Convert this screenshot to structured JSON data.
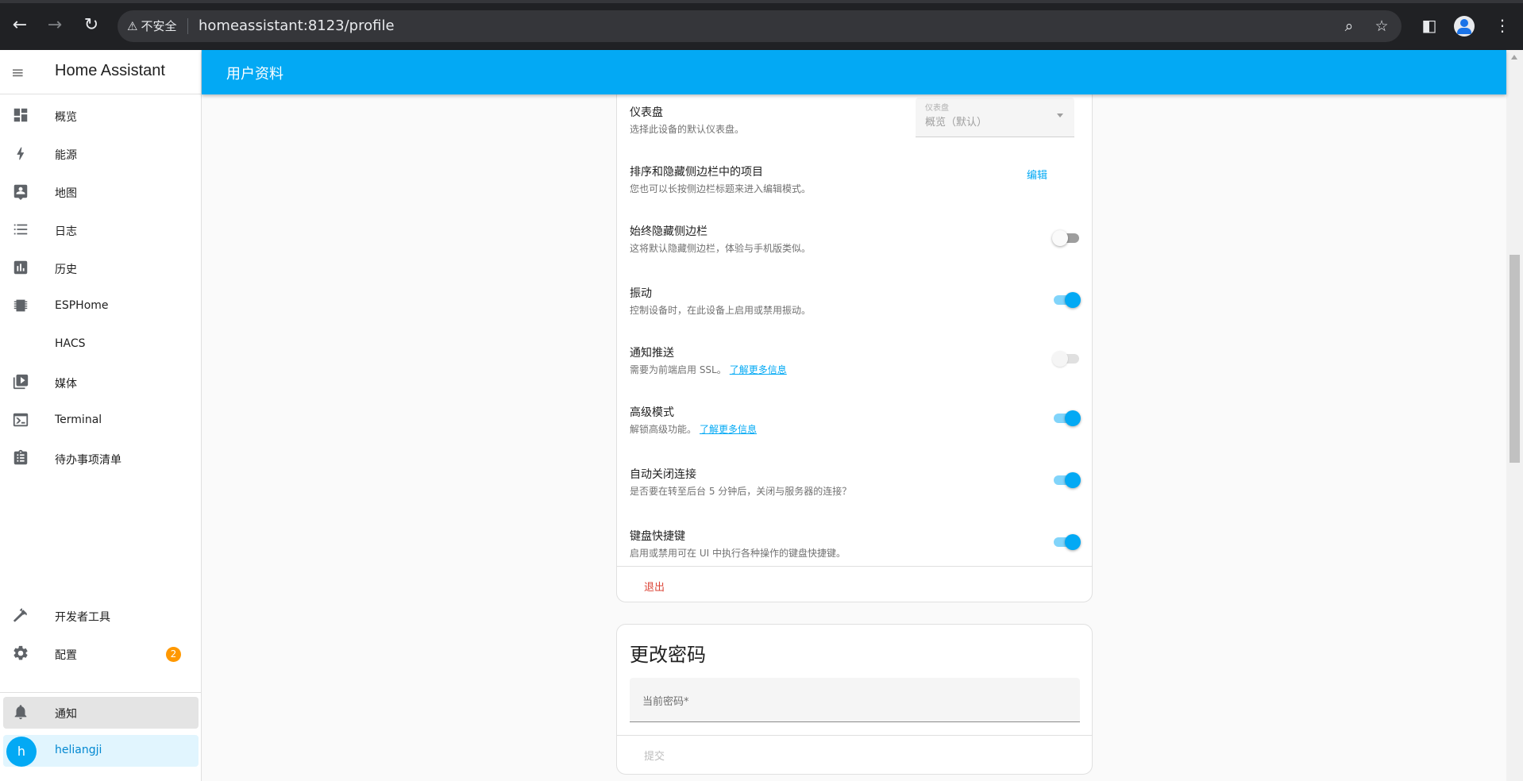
{
  "browser": {
    "security_label": "不安全",
    "url": "homeassistant:8123/profile"
  },
  "sidebar": {
    "title": "Home Assistant",
    "items": [
      {
        "label": "概览",
        "icon": "dashboard-icon"
      },
      {
        "label": "能源",
        "icon": "lightning-icon"
      },
      {
        "label": "地图",
        "icon": "map-account-icon"
      },
      {
        "label": "日志",
        "icon": "list-icon"
      },
      {
        "label": "历史",
        "icon": "chart-icon"
      },
      {
        "label": "ESPHome",
        "icon": "chip-icon"
      },
      {
        "label": "HACS",
        "icon": ""
      },
      {
        "label": "媒体",
        "icon": "media-play-icon"
      },
      {
        "label": "Terminal",
        "icon": "console-icon"
      },
      {
        "label": "待办事项清单",
        "icon": "clipboard-list-icon"
      }
    ],
    "developer_tools": "开发者工具",
    "settings": "配置",
    "settings_badge": "2",
    "notifications": "通知",
    "user_initial": "h",
    "user_name": "heliangji"
  },
  "header": {
    "title": "用户资料"
  },
  "settings": {
    "dashboard": {
      "title": "仪表盘",
      "desc": "选择此设备的默认仪表盘。",
      "select_label": "仪表盘",
      "select_value": "概览（默认）"
    },
    "sidebar_order": {
      "title": "排序和隐藏侧边栏中的项目",
      "desc": "您也可以长按侧边栏标题来进入编辑模式。",
      "button": "编辑"
    },
    "hide_sidebar": {
      "title": "始终隐藏侧边栏",
      "desc": "这将默认隐藏侧边栏，体验与手机版类似。",
      "state": "off"
    },
    "vibrate": {
      "title": "振动",
      "desc": "控制设备时，在此设备上启用或禁用振动。",
      "state": "on"
    },
    "push": {
      "title": "通知推送",
      "desc": "需要为前端启用 SSL。",
      "link": "了解更多信息",
      "state": "disabled"
    },
    "advanced": {
      "title": "高级模式",
      "desc": "解锁高级功能。",
      "link": "了解更多信息",
      "state": "on"
    },
    "auto_close": {
      "title": "自动关闭连接",
      "desc": "是否要在转至后台 5 分钟后，关闭与服务器的连接？",
      "state": "on"
    },
    "shortcuts": {
      "title": "键盘快捷键",
      "desc": "启用或禁用可在 UI 中执行各种操作的键盘快捷键。",
      "state": "on"
    },
    "logout": "退出"
  },
  "change_password": {
    "title": "更改密码",
    "current_password_label": "当前密码*",
    "submit": "提交"
  },
  "colors": {
    "primary": "#03a9f4",
    "badge": "#ff9800",
    "logout": "#db4437"
  }
}
